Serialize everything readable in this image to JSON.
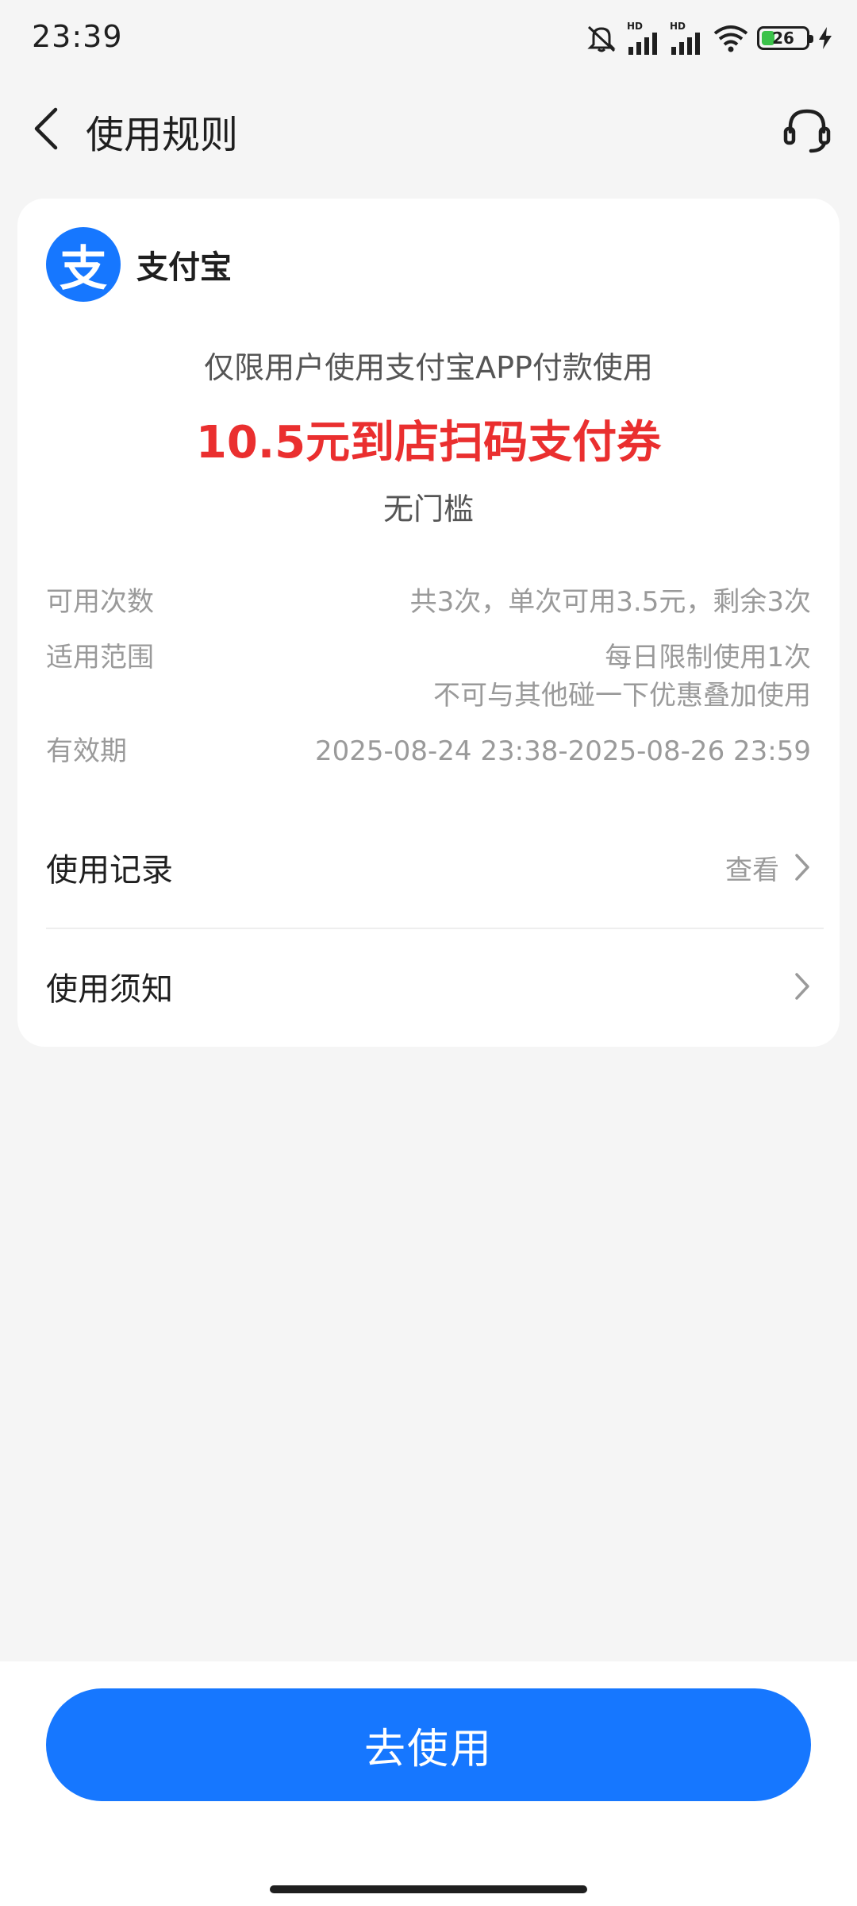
{
  "status_bar": {
    "time": "23:39",
    "network_1": "HD",
    "network_2": "HD",
    "battery": "26"
  },
  "header": {
    "title": "使用规则"
  },
  "card": {
    "brand_name": "支付宝",
    "brand_logo_char": "支",
    "limit_note": "仅限用户使用支付宝APP付款使用",
    "coupon_title": "10.5元到店扫码支付券",
    "threshold": "无门槛",
    "info": [
      {
        "key": "可用次数",
        "value_lines": [
          "共3次，单次可用3.5元，剩余3次"
        ]
      },
      {
        "key": "适用范围",
        "value_lines": [
          "每日限制使用1次",
          "不可与其他碰一下优惠叠加使用"
        ]
      },
      {
        "key": "有效期",
        "value_lines": [
          "2025-08-24 23:38-2025-08-26 23:59"
        ]
      }
    ],
    "records": {
      "label": "使用记录",
      "action": "查看"
    },
    "notice": {
      "label": "使用须知"
    }
  },
  "bottom": {
    "use_button_label": "去使用"
  },
  "colors": {
    "accent": "#1677ff",
    "highlight": "#ea2f2f",
    "background": "#f5f5f5"
  }
}
